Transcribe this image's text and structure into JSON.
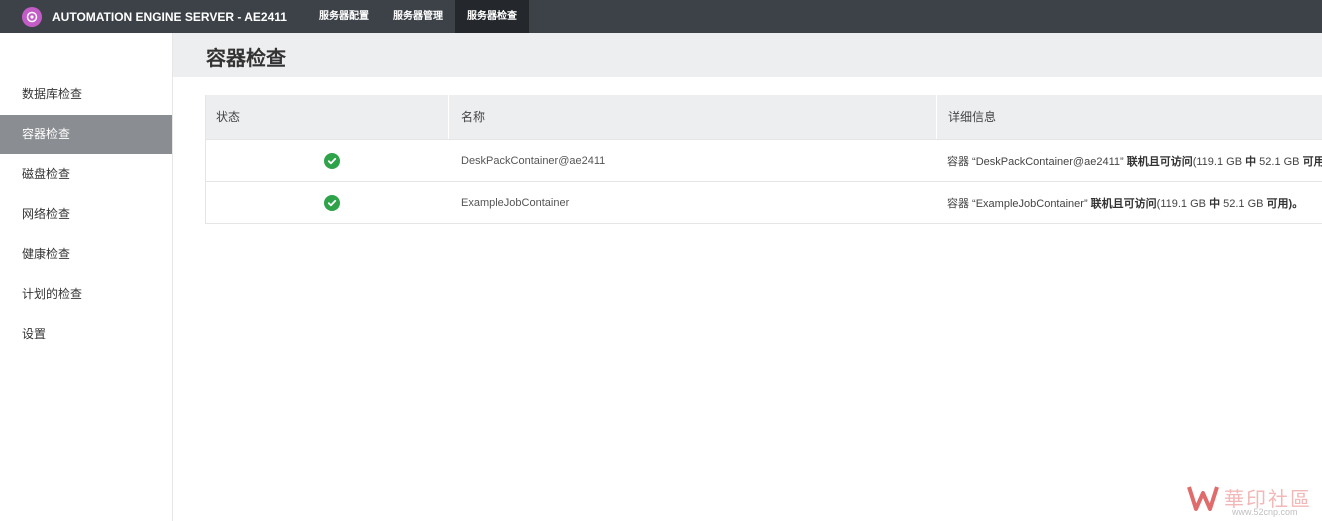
{
  "header": {
    "app_title": "AUTOMATION ENGINE SERVER - AE2411",
    "tabs": [
      {
        "label": "服务器配置",
        "active": false
      },
      {
        "label": "服务器管理",
        "active": false
      },
      {
        "label": "服务器检查",
        "active": true
      }
    ]
  },
  "sidebar": {
    "items": [
      {
        "label": "数据库检查",
        "active": false
      },
      {
        "label": "容器检查",
        "active": true
      },
      {
        "label": "磁盘检查",
        "active": false
      },
      {
        "label": "网络检查",
        "active": false
      },
      {
        "label": "健康检查",
        "active": false
      },
      {
        "label": "计划的检查",
        "active": false
      },
      {
        "label": "设置",
        "active": false
      }
    ]
  },
  "main": {
    "title": "容器检查",
    "table": {
      "headers": {
        "status": "状态",
        "name": "名称",
        "detail": "详细信息"
      },
      "rows": [
        {
          "status_icon": "check-circle-icon",
          "name": "DeskPackContainer@ae2411",
          "detail_prefix": "容器 “DeskPackContainer@ae2411” ",
          "detail_bold": "联机且可访问",
          "detail_mid": "(119.1 GB ",
          "detail_bold2": "中",
          "detail_mid2": " 52.1 GB ",
          "detail_bold3": "可用)。"
        },
        {
          "status_icon": "check-circle-icon",
          "name": "ExampleJobContainer",
          "detail_prefix": "容器 “ExampleJobContainer” ",
          "detail_bold": "联机且可访问",
          "detail_mid": "(119.1 GB ",
          "detail_bold2": "中",
          "detail_mid2": " 52.1 GB ",
          "detail_bold3": "可用)。"
        }
      ]
    }
  },
  "watermark": {
    "text": "華印社區",
    "url": "www.52cnp.com"
  },
  "colors": {
    "topbar": "#3d4249",
    "active_tab": "#24282d",
    "sidebar_active": "#8a8d91",
    "status_ok": "#2fa34a",
    "logo": "#c45cc8"
  }
}
